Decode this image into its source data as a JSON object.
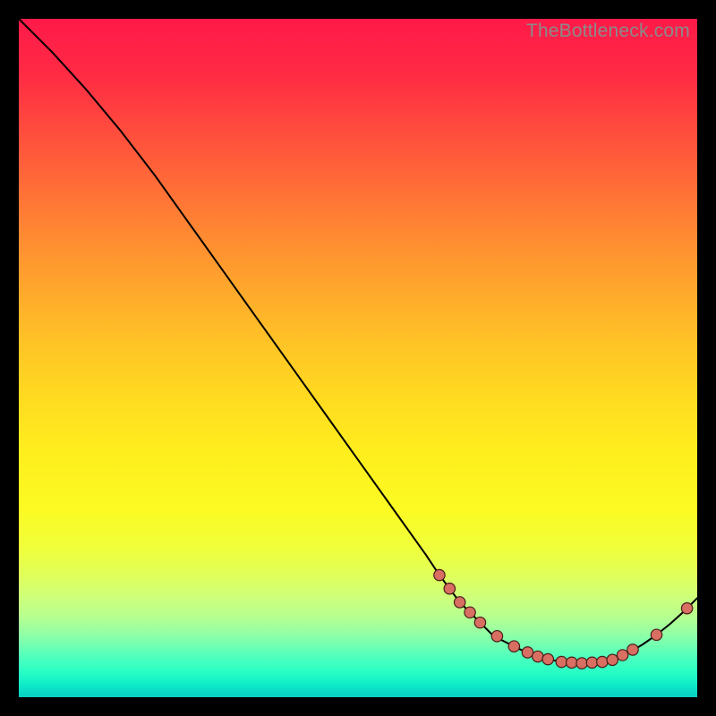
{
  "watermark": "TheBottleneck.com",
  "chart_data": {
    "type": "line",
    "title": "",
    "xlabel": "",
    "ylabel": "",
    "xlim": [
      0,
      100
    ],
    "ylim": [
      0,
      100
    ],
    "series": [
      {
        "name": "curve",
        "x": [
          0,
          5,
          10,
          15,
          20,
          25,
          30,
          35,
          40,
          45,
          50,
          55,
          60,
          62,
          65,
          68,
          70,
          72,
          74,
          76,
          78,
          80,
          82,
          84,
          86,
          88,
          90,
          92,
          94,
          96,
          98,
          100
        ],
        "values": [
          100,
          95,
          89.5,
          83.5,
          77,
          70,
          63,
          56,
          49,
          42,
          35,
          28,
          21,
          18,
          14,
          11,
          9,
          8,
          7,
          6.2,
          5.6,
          5.2,
          5,
          5,
          5.2,
          5.8,
          6.6,
          7.8,
          9.2,
          10.8,
          12.6,
          14.6
        ]
      }
    ],
    "markers": [
      {
        "x": 62.0,
        "y": 18.0
      },
      {
        "x": 63.5,
        "y": 16.0
      },
      {
        "x": 65.0,
        "y": 14.0
      },
      {
        "x": 66.5,
        "y": 12.5
      },
      {
        "x": 68.0,
        "y": 11.0
      },
      {
        "x": 70.5,
        "y": 9.0
      },
      {
        "x": 73.0,
        "y": 7.5
      },
      {
        "x": 75.0,
        "y": 6.6
      },
      {
        "x": 76.5,
        "y": 6.0
      },
      {
        "x": 78.0,
        "y": 5.6
      },
      {
        "x": 80.0,
        "y": 5.2
      },
      {
        "x": 81.5,
        "y": 5.1
      },
      {
        "x": 83.0,
        "y": 5.0
      },
      {
        "x": 84.5,
        "y": 5.1
      },
      {
        "x": 86.0,
        "y": 5.2
      },
      {
        "x": 87.5,
        "y": 5.5
      },
      {
        "x": 89.0,
        "y": 6.2
      },
      {
        "x": 90.5,
        "y": 7.0
      },
      {
        "x": 94.0,
        "y": 9.2
      },
      {
        "x": 98.5,
        "y": 13.1
      }
    ],
    "marker_style": {
      "fill": "#d86f62",
      "stroke": "#4a1e18",
      "r": 6.2
    }
  }
}
